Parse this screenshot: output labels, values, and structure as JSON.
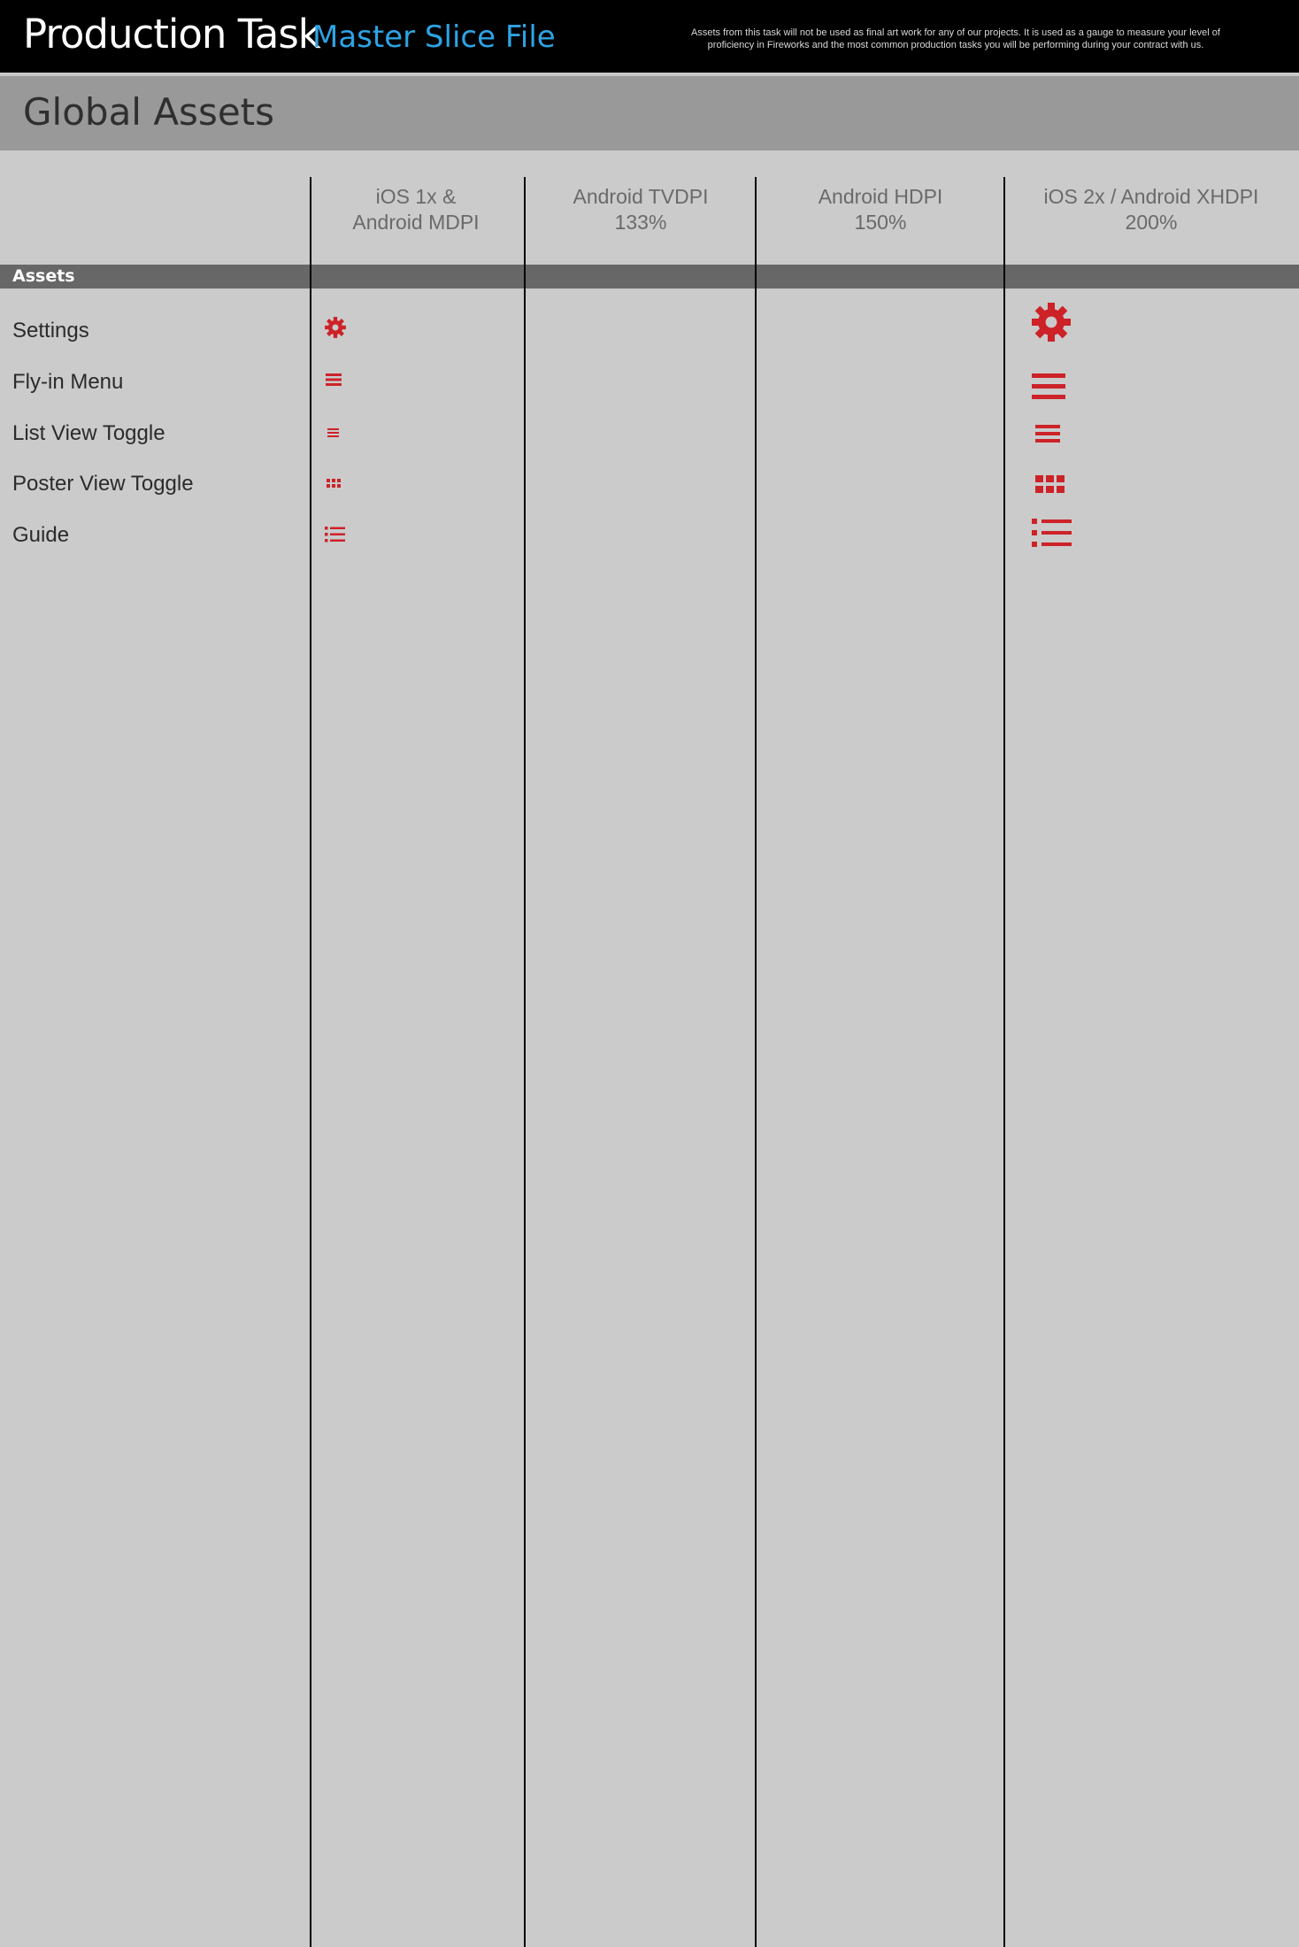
{
  "header": {
    "title": "Production Task",
    "subtitle": "Master Slice File",
    "disclaimer_line1": "Assets from this task will not be used as final art work for any of our projects. It is used as a gauge to measure your level of",
    "disclaimer_line2": "proficiency in Fireworks and the most common production tasks you will be performing during your contract with us."
  },
  "section": {
    "title": "Global Assets",
    "group_label": "Assets"
  },
  "columns": [
    {
      "line1": "iOS 1x &",
      "line2": "Android MDPI"
    },
    {
      "line1": "Android TVDPI",
      "line2": "133%"
    },
    {
      "line1": "Android HDPI",
      "line2": "150%"
    },
    {
      "line1": "iOS 2x / Android XHDPI",
      "line2": "200%"
    }
  ],
  "rows": [
    {
      "label": "Settings",
      "icon": "gear-icon"
    },
    {
      "label": "Fly-in Menu",
      "icon": "hamburger-menu-icon"
    },
    {
      "label": "List View Toggle",
      "icon": "list-view-icon"
    },
    {
      "label": "Poster View Toggle",
      "icon": "grid-view-icon"
    },
    {
      "label": "Guide",
      "icon": "bulleted-list-icon"
    }
  ],
  "colors": {
    "header_bg": "#000000",
    "subtitle": "#2ea3e3",
    "section_bg": "#999999",
    "band_bg": "#676767",
    "page_bg": "#cbcbcb",
    "icon_red": "#cc2228"
  }
}
